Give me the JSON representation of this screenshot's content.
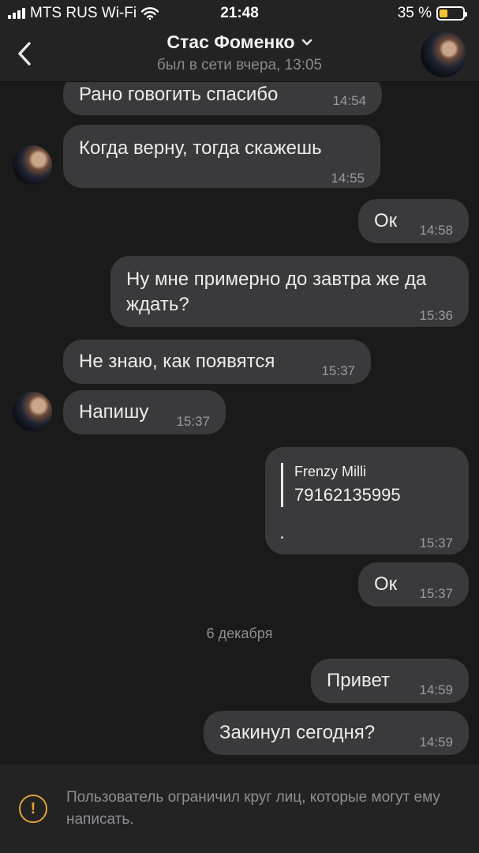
{
  "status_bar": {
    "carrier": "MTS RUS Wi-Fi",
    "time": "21:48",
    "battery_percent": "35 %",
    "battery_level": 0.35,
    "battery_color": "#f2c230"
  },
  "header": {
    "back_icon": "chevron-left-icon",
    "contact_name": "Стас Фоменко",
    "dropdown_icon": "chevron-down-icon",
    "last_seen": "был в сети вчера, 13:05"
  },
  "messages": [
    {
      "direction": "in",
      "text": "Рано говогить спасибо",
      "time": "14:54"
    },
    {
      "direction": "in",
      "text": "Когда верну, тогда скажешь",
      "time": "14:55"
    },
    {
      "direction": "out",
      "text": "Ок",
      "time": "14:58"
    },
    {
      "direction": "out",
      "text": "Ну мне примерно до завтра же да ждать?",
      "time": "15:36"
    },
    {
      "direction": "in",
      "text": "Не знаю, как появятся",
      "time": "15:37"
    },
    {
      "direction": "in",
      "text": "Напишу",
      "time": "15:37"
    },
    {
      "direction": "out",
      "quote_name": "Frenzy Milli",
      "quote_text": "79162135995",
      "extra_text": ".",
      "time": "15:37"
    },
    {
      "direction": "out",
      "text": "Ок",
      "time": "15:37"
    },
    {
      "direction": "out",
      "text": "Привет",
      "time": "14:59"
    },
    {
      "direction": "out",
      "text": "Закинул сегодня?",
      "time": "14:59"
    }
  ],
  "date_separator": "6 декабря",
  "footer": {
    "warning_icon": "exclamation-circle-icon",
    "warning_text": "Пользователь ограничил круг лиц, которые могут ему написать.",
    "accent_color": "#e0a339"
  }
}
